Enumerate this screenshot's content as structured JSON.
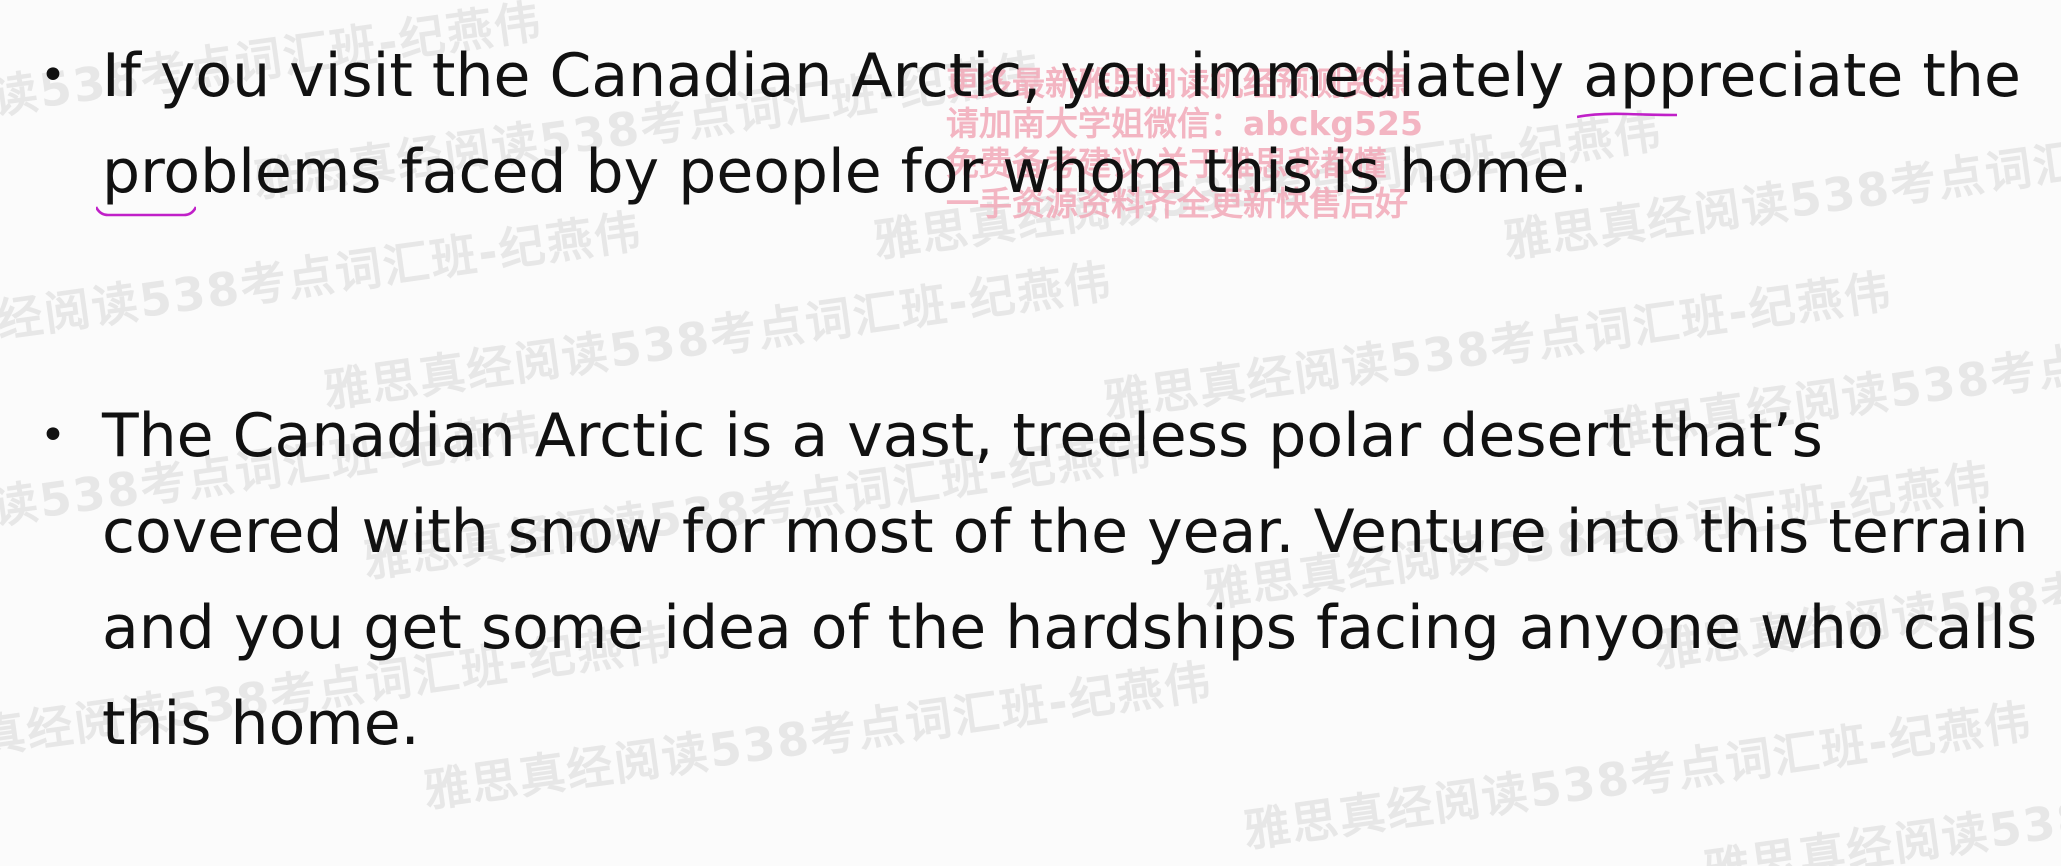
{
  "watermark": {
    "text": "雅思真经阅读538考点词汇班-纪燕伟"
  },
  "promo": {
    "lines": [
      "更多最新雅思阅读机经预测资源",
      "请加南大学姐微信：abckg525",
      "免费备考建议 关于雅思我都懂",
      "一手资源资料齐全更新快售后好"
    ]
  },
  "bullets": [
    {
      "symbol": "•",
      "segments": {
        "s1": "If you visit the Canadian Arctic, you immediately ",
        "appreciate": "appreciate",
        "s2": " the ",
        "problems": "problems",
        "s3": " ",
        "faced_by_people": "faced by people",
        "s4": " for whom this is home."
      }
    },
    {
      "symbol": "•",
      "text": "The Canadian Arctic is a vast, treeless polar desert that’s covered with snow for most of the year. Venture into this terrain and you get some idea of the hardships facing anyone who calls this home."
    }
  ],
  "annotation_color": "#c020c8"
}
